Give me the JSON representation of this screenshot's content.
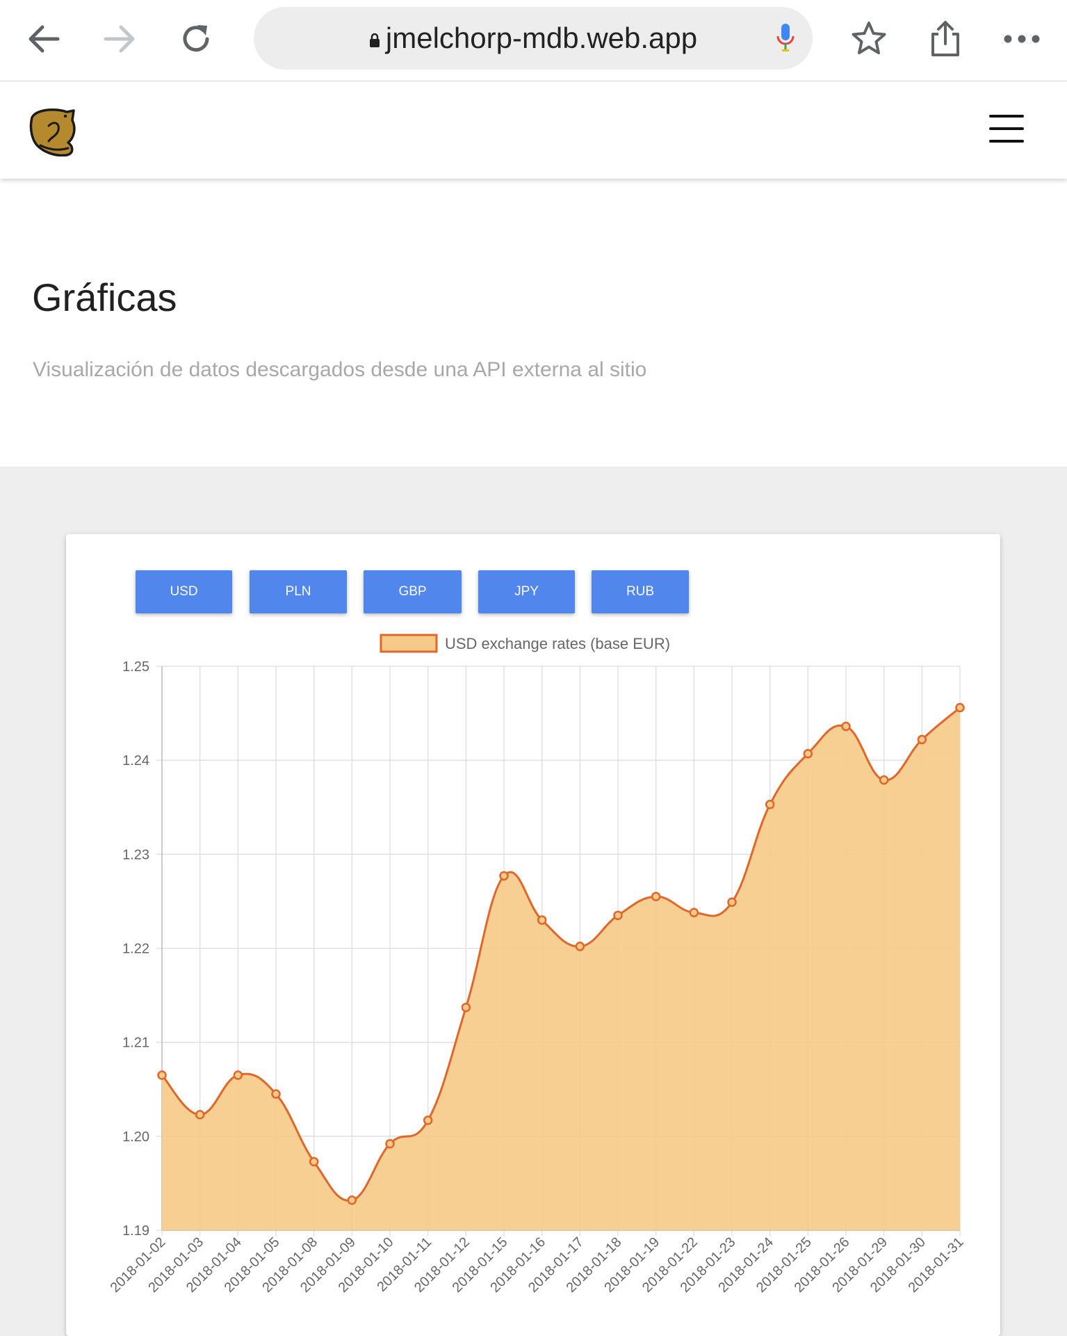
{
  "browser": {
    "url": "jmelchorp-mdb.web.app"
  },
  "header": {
    "title": "Gráficas",
    "subtitle": "Visualización de datos descargados desde una API externa al sitio"
  },
  "currency_buttons": [
    "USD",
    "PLN",
    "GBP",
    "JPY",
    "RUB"
  ],
  "chart_data": {
    "type": "area",
    "x": [
      "2018-01-02",
      "2018-01-03",
      "2018-01-04",
      "2018-01-05",
      "2018-01-08",
      "2018-01-09",
      "2018-01-10",
      "2018-01-11",
      "2018-01-12",
      "2018-01-15",
      "2018-01-16",
      "2018-01-17",
      "2018-01-18",
      "2018-01-19",
      "2018-01-22",
      "2018-01-23",
      "2018-01-24",
      "2018-01-25",
      "2018-01-26",
      "2018-01-29",
      "2018-01-30",
      "2018-01-31"
    ],
    "series": [
      {
        "name": "USD exchange rates (base EUR)",
        "values": [
          1.2065,
          1.2023,
          1.2065,
          1.2045,
          1.1973,
          1.1932,
          1.1992,
          1.2017,
          1.2137,
          1.2277,
          1.223,
          1.2202,
          1.2235,
          1.2255,
          1.2238,
          1.2249,
          1.2353,
          1.2407,
          1.2436,
          1.2379,
          1.2422,
          1.2456
        ]
      }
    ],
    "y_ticks": [
      "1.25",
      "1.24",
      "1.23",
      "1.22",
      "1.21",
      "1.20",
      "1.19"
    ],
    "ylim": [
      1.19,
      1.25
    ],
    "grid": true,
    "legend": "top-center",
    "colors": {
      "line": "#e0662a",
      "fill": "#f6cb8a"
    }
  }
}
